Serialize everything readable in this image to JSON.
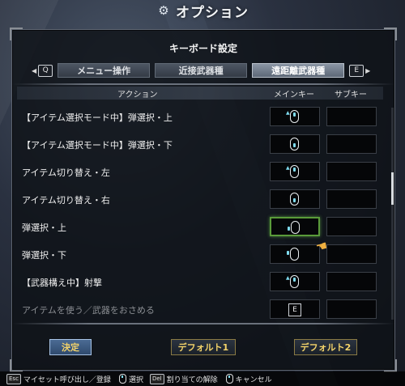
{
  "title": "オプション",
  "panel_heading": "キーボード設定",
  "tabs": {
    "prev_key": "Q",
    "next_key": "E",
    "items": [
      {
        "label": "メニュー操作",
        "active": false
      },
      {
        "label": "近接武器種",
        "active": false
      },
      {
        "label": "遠距離武器種",
        "active": true
      }
    ]
  },
  "columns": {
    "action": "アクション",
    "main": "メインキー",
    "sub": "サブキー"
  },
  "rows": [
    {
      "label": "【アイテム選択モード中】弾選択・上",
      "main": "mouse-wheel-up-icon",
      "sub": ""
    },
    {
      "label": "【アイテム選択モード中】弾選択・下",
      "main": "mouse-wheel-down-icon",
      "sub": ""
    },
    {
      "label": "アイテム切り替え・左",
      "main": "mouse-wheel-up-icon",
      "sub": ""
    },
    {
      "label": "アイテム切り替え・右",
      "main": "mouse-wheel-down-icon",
      "sub": ""
    },
    {
      "label": "弾選択・上",
      "main": "mouse-side-button-icon",
      "sub": "",
      "selected": true
    },
    {
      "label": "弾選択・下",
      "main": "mouse-side-button-icon",
      "sub": ""
    },
    {
      "label": "【武器構え中】射撃",
      "main": "mouse-wheel-up-icon",
      "sub": ""
    },
    {
      "label": "アイテムを使う／武器をおさめる",
      "main": "E",
      "sub": ""
    }
  ],
  "buttons": {
    "confirm": "決定",
    "default1": "デフォルト1",
    "default2": "デフォルト2"
  },
  "footer": {
    "esc_key": "Esc",
    "esc_label": "マイセット呼び出し／登録",
    "select_label": "選択",
    "del_key": "Del",
    "del_label": "割り当ての解除",
    "cancel_label": "キャンセル"
  },
  "colors": {
    "accent_text": "#f3d36a",
    "selected_border": "#5a9b3a",
    "mouse_highlight": "#7fdcf0"
  }
}
